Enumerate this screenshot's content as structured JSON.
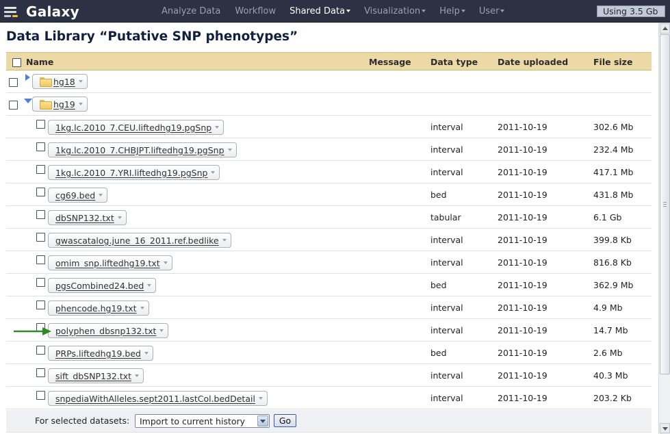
{
  "masthead": {
    "brand": "Galaxy",
    "nav": [
      {
        "label": "Analyze Data",
        "active": false,
        "caret": false
      },
      {
        "label": "Workflow",
        "active": false,
        "caret": false
      },
      {
        "label": "Shared Data",
        "active": true,
        "caret": true
      },
      {
        "label": "Visualization",
        "active": false,
        "caret": true
      },
      {
        "label": "Help",
        "active": false,
        "caret": true
      },
      {
        "label": "User",
        "active": false,
        "caret": true
      }
    ],
    "usage": "Using 3.5 Gb"
  },
  "page": {
    "title": "Data Library “Putative SNP phenotypes”"
  },
  "table": {
    "headers": {
      "name": "Name",
      "message": "Message",
      "data_type": "Data type",
      "date_uploaded": "Date uploaded",
      "file_size": "File size"
    },
    "folders": [
      {
        "name": "hg18",
        "expanded": false
      },
      {
        "name": "hg19",
        "expanded": true
      }
    ],
    "datasets": [
      {
        "name": "1kg.lc.2010_7.CEU.liftedhg19.pgSnp",
        "type": "interval",
        "date": "2011-10-19",
        "size": "302.6 Mb"
      },
      {
        "name": "1kg.lc.2010_7.CHBJPT.liftedhg19.pgSnp",
        "type": "interval",
        "date": "2011-10-19",
        "size": "232.4 Mb"
      },
      {
        "name": "1kg.lc.2010_7.YRI.liftedhg19.pgSnp",
        "type": "interval",
        "date": "2011-10-19",
        "size": "417.1 Mb"
      },
      {
        "name": "cg69.bed",
        "type": "bed",
        "date": "2011-10-19",
        "size": "431.8 Mb"
      },
      {
        "name": "dbSNP132.txt",
        "type": "tabular",
        "date": "2011-10-19",
        "size": "6.1 Gb"
      },
      {
        "name": "gwascatalog.june_16_2011.ref.bedlike",
        "type": "interval",
        "date": "2011-10-19",
        "size": "399.8 Kb"
      },
      {
        "name": "omim_snp.liftedhg19.txt",
        "type": "interval",
        "date": "2011-10-19",
        "size": "816.8 Kb"
      },
      {
        "name": "pgsCombined24.bed",
        "type": "bed",
        "date": "2011-10-19",
        "size": "362.9 Mb"
      },
      {
        "name": "phencode.hg19.txt",
        "type": "interval",
        "date": "2011-10-19",
        "size": "4.9 Mb"
      },
      {
        "name": "polyphen_dbsnp132.txt",
        "type": "interval",
        "date": "2011-10-19",
        "size": "14.7 Mb"
      },
      {
        "name": "PRPs.liftedhg19.bed",
        "type": "bed",
        "date": "2011-10-19",
        "size": "2.6 Mb"
      },
      {
        "name": "sift_dbSNP132.txt",
        "type": "interval",
        "date": "2011-10-19",
        "size": "40.3 Mb"
      },
      {
        "name": "snpediaWithAlleles.sept2011.lastCol.bedDetail",
        "type": "interval",
        "date": "2011-10-19",
        "size": "203.2 Kb"
      }
    ]
  },
  "footer": {
    "label": "For selected datasets:",
    "select_value": "Import to current history",
    "go_label": "Go"
  },
  "colors": {
    "masthead": "#2c3143",
    "header_bg": "#ecd9a6",
    "title": "#11203f",
    "arrow": "#2e8b22",
    "expander": "#4c7fd6"
  },
  "icons": [
    "galaxy-logo-icon",
    "folder-icon",
    "expand-arrow-icon",
    "collapse-arrow-icon",
    "caret-down-icon",
    "annotation-arrow-icon"
  ]
}
